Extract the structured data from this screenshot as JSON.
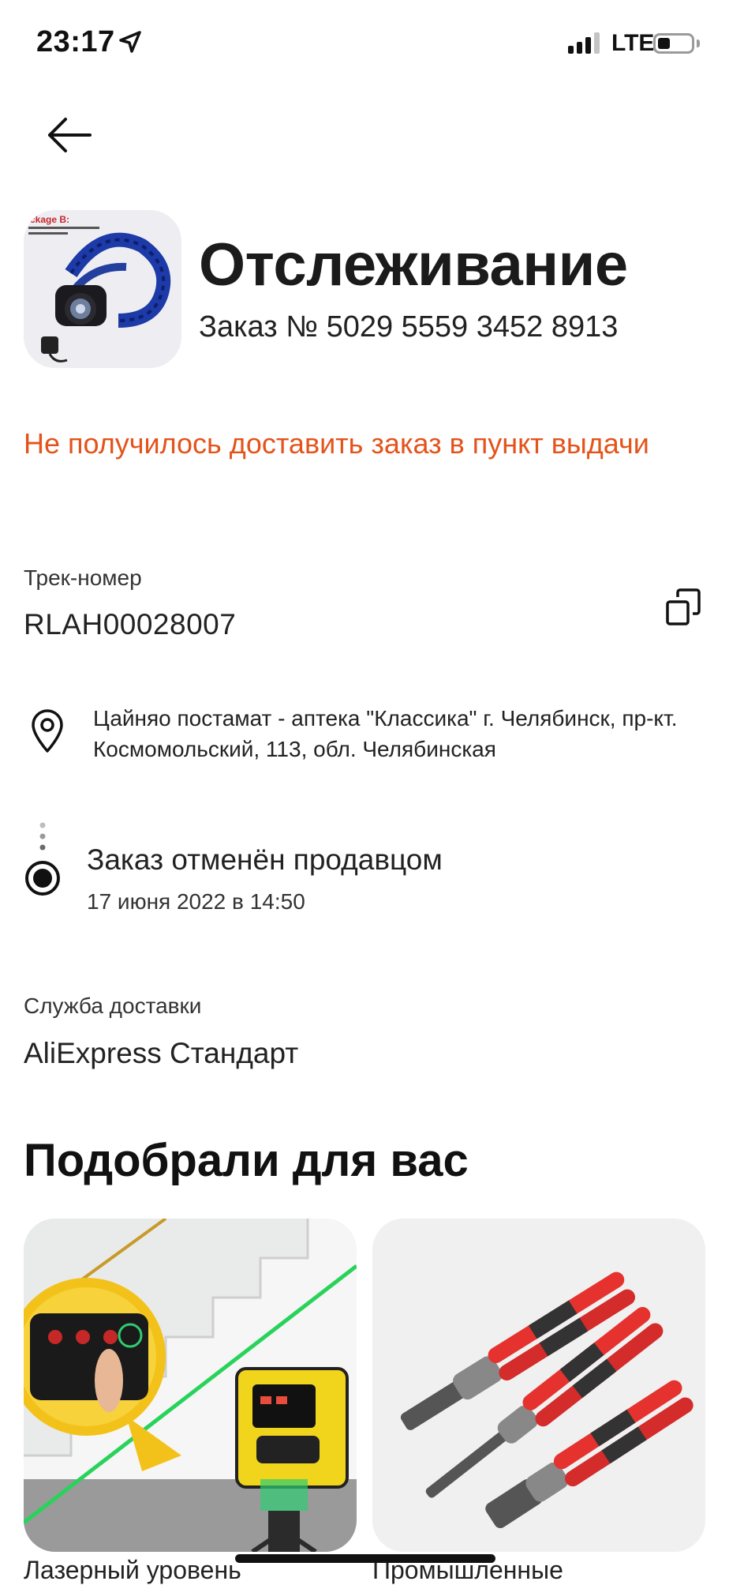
{
  "status_bar": {
    "time": "23:17",
    "network": "LTE",
    "icons": [
      "location-arrow-icon",
      "signal-icon",
      "battery-icon"
    ]
  },
  "header": {
    "back_icon": "arrow-left-icon",
    "title": "Отслеживание",
    "order_prefix": "Заказ № ",
    "order_number": "5029 5559 3452 8913",
    "thumb_text": "ckage B:"
  },
  "alert": {
    "text": "Не получилось доставить заказ в пункт выдачи",
    "color": "#e4531b"
  },
  "tracking": {
    "label": "Трек-номер",
    "number": "RLAH00028007",
    "copy_icon": "copy-icon"
  },
  "pickup": {
    "icon": "map-pin-icon",
    "address": "Цайняо постамат - аптека \"Классика\" г. Челябинск, пр-кт. Космомольский, 113, обл. Челябинская"
  },
  "order_status": {
    "text": "Заказ отменён продавцом",
    "date": "17 июня 2022 в 14:50"
  },
  "delivery": {
    "label": "Служба доставки",
    "service": "AliExpress Стандарт"
  },
  "recommendations": {
    "title": "Подобрали для вас",
    "items": [
      {
        "label": "Лазерный уровень"
      },
      {
        "label": "Промышленные"
      }
    ]
  }
}
